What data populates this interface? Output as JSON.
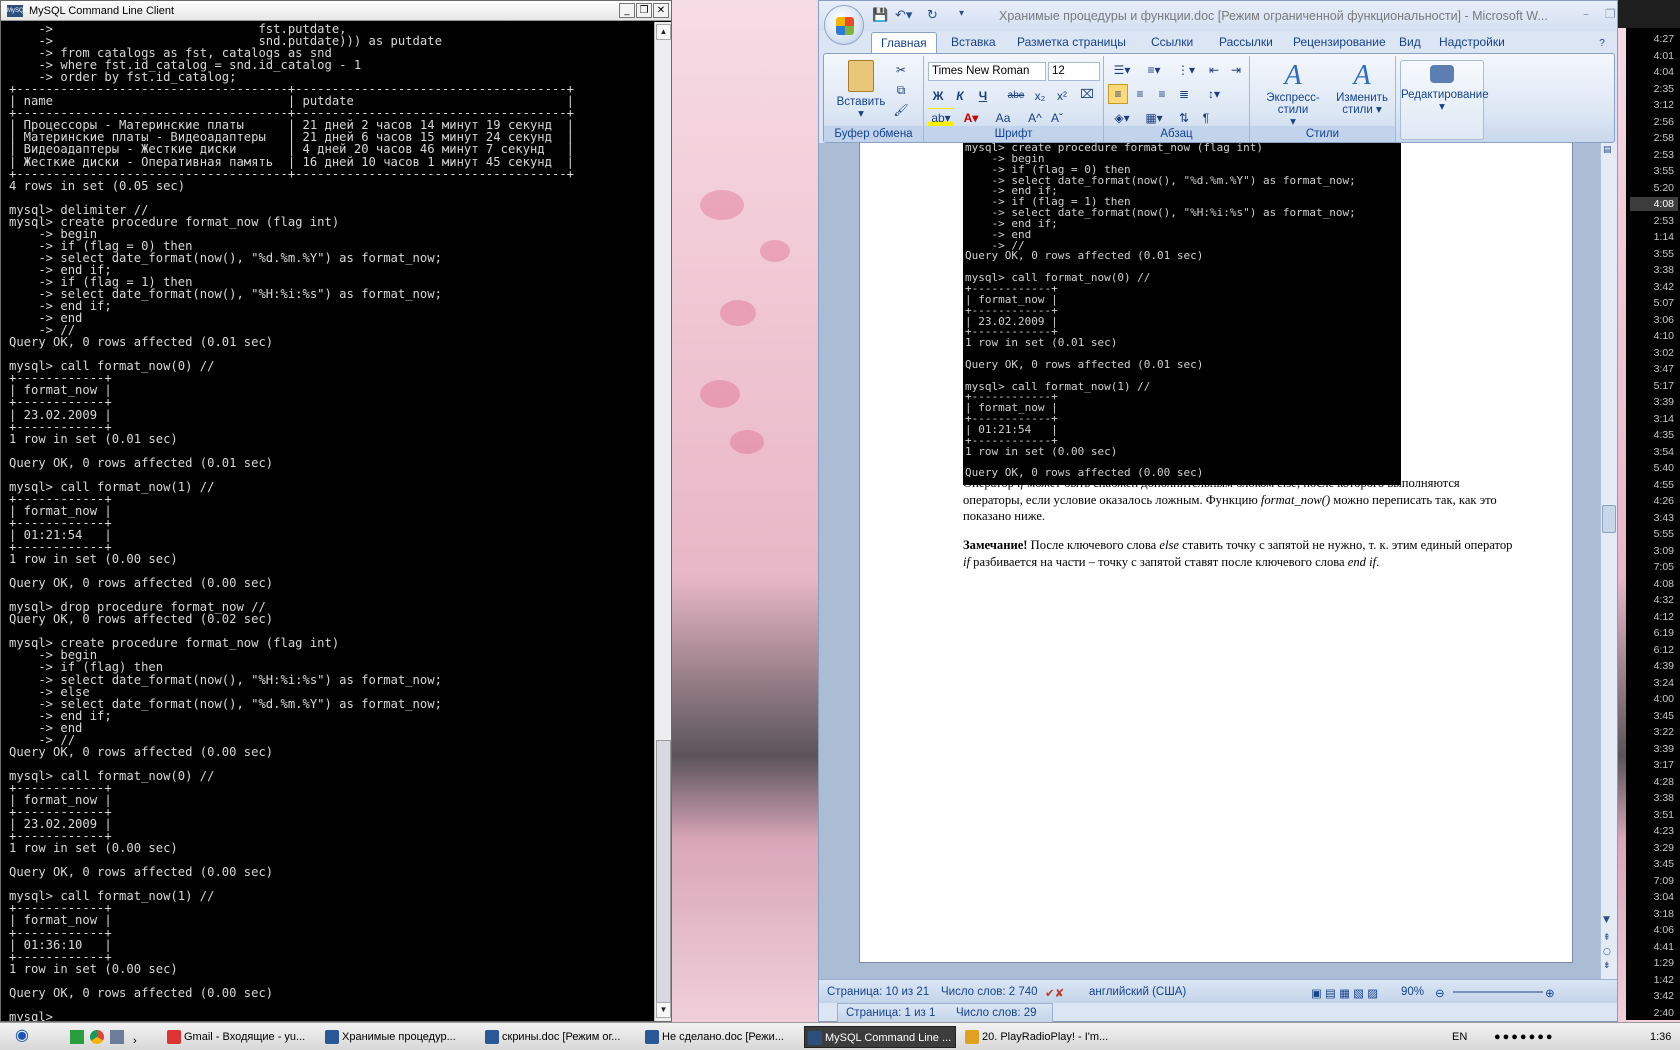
{
  "mysql_window": {
    "title": "MySQL Command Line Client",
    "icon_label": "MySQL",
    "lines": [
      "    ->                            fst.putdate,",
      "    ->                            snd.putdate))) as putdate",
      "    -> from catalogs as fst, catalogs as snd",
      "    -> where fst.id_catalog = snd.id_catalog - 1",
      "    -> order by fst.id_catalog;",
      "+-------------------------------------+-------------------------------------+",
      "| name                                | putdate                             |",
      "+-------------------------------------+-------------------------------------+",
      "| Процессоры - Материнские платы      | 21 дней 2 часов 14 минут 19 секунд  |",
      "| Материнские платы - Видеоадаптеры   | 21 дней 6 часов 15 минут 24 секунд  |",
      "| Видеоадаптеры - Жесткие диски       | 4 дней 20 часов 46 минут 7 секунд   |",
      "| Жесткие диски - Оперативная память  | 16 дней 10 часов 1 минут 45 секунд  |",
      "+-------------------------------------+-------------------------------------+",
      "4 rows in set (0.05 sec)",
      "",
      "mysql> delimiter //",
      "mysql> create procedure format_now (flag int)",
      "    -> begin",
      "    -> if (flag = 0) then",
      "    -> select date_format(now(), \"%d.%m.%Y\") as format_now;",
      "    -> end if;",
      "    -> if (flag = 1) then",
      "    -> select date_format(now(), \"%H:%i:%s\") as format_now;",
      "    -> end if;",
      "    -> end",
      "    -> //",
      "Query OK, 0 rows affected (0.01 sec)",
      "",
      "mysql> call format_now(0) //",
      "+------------+",
      "| format_now |",
      "+------------+",
      "| 23.02.2009 |",
      "+------------+",
      "1 row in set (0.01 sec)",
      "",
      "Query OK, 0 rows affected (0.01 sec)",
      "",
      "mysql> call format_now(1) //",
      "+------------+",
      "| format_now |",
      "+------------+",
      "| 01:21:54   |",
      "+------------+",
      "1 row in set (0.00 sec)",
      "",
      "Query OK, 0 rows affected (0.00 sec)",
      "",
      "mysql> drop procedure format_now //",
      "Query OK, 0 rows affected (0.02 sec)",
      "",
      "mysql> create procedure format_now (flag int)",
      "    -> begin",
      "    -> if (flag) then",
      "    -> select date_format(now(), \"%H:%i:%s\") as format_now;",
      "    -> else",
      "    -> select date_format(now(), \"%d.%m.%Y\") as format_now;",
      "    -> end if;",
      "    -> end",
      "    -> //",
      "Query OK, 0 rows affected (0.00 sec)",
      "",
      "mysql> call format_now(0) //",
      "+------------+",
      "| format_now |",
      "+------------+",
      "| 23.02.2009 |",
      "+------------+",
      "1 row in set (0.00 sec)",
      "",
      "Query OK, 0 rows affected (0.00 sec)",
      "",
      "mysql> call format_now(1) //",
      "+------------+",
      "| format_now |",
      "+------------+",
      "| 01:36:10   |",
      "+------------+",
      "1 row in set (0.00 sec)",
      "",
      "Query OK, 0 rows affected (0.00 sec)",
      "",
      "mysql> _"
    ]
  },
  "word_window": {
    "title": "Хранимые процедуры и функции.doc [Режим ограниченной функциональности] - Microsoft W...",
    "tabs": [
      "Главная",
      "Вставка",
      "Разметка страницы",
      "Ссылки",
      "Рассылки",
      "Рецензирование",
      "Вид",
      "Надстройки"
    ],
    "groups": {
      "clipboard": "Буфер обмена",
      "font": "Шрифт",
      "paragraph": "Абзац",
      "styles": "Стили"
    },
    "paste_label": "Вставить",
    "font_name": "Times New Roman",
    "font_size": "12",
    "bold": "Ж",
    "italic": "К",
    "underline": "Ч",
    "strike": "abe",
    "subscript": "x₂",
    "superscript": "x²",
    "case": "Аа",
    "grow": "A^",
    "shrink": "Aˇ",
    "pilcrow": "¶",
    "express_styles": "Экспресс-стили",
    "change_styles_1": "Изменить",
    "change_styles_2": "стили",
    "editing": "Редактирование",
    "doc_console_lines": [
      "mysql> create procedure format_now (flag int)",
      "    -> begin",
      "    -> if (flag = 0) then",
      "    -> select date_format(now(), \"%d.%m.%Y\") as format_now;",
      "    -> end if;",
      "    -> if (flag = 1) then",
      "    -> select date_format(now(), \"%H:%i:%s\") as format_now;",
      "    -> end if;",
      "    -> end",
      "    -> //",
      "Query OK, 0 rows affected (0.01 sec)",
      "",
      "mysql> call format_now(0) //",
      "+------------+",
      "| format_now |",
      "+------------+",
      "| 23.02.2009 |",
      "+------------+",
      "1 row in set (0.01 sec)",
      "",
      "Query OK, 0 rows affected (0.01 sec)",
      "",
      "mysql> call format_now(1) //",
      "+------------+",
      "| format_now |",
      "+------------+",
      "| 01:21:54   |",
      "+------------+",
      "1 row in set (0.00 sec)",
      "",
      "Query OK, 0 rows affected (0.00 sec)"
    ],
    "para1": {
      "a": "Оператор ",
      "b": "if",
      "c": " может быть снабжен дополнительным блоком ",
      "d": "else",
      "e": ", после которого выполняются операторы, если условие оказалось ложным. Функцию ",
      "f": "format_now()",
      "g": " можно переписать так, как это показано ниже."
    },
    "para2": {
      "a": "Замечание!",
      "b": " После ключевого слова ",
      "c": "else",
      "d": " ставить точку с запятой не нужно, т. к. этим единый оператор ",
      "e": "if",
      "f": " разбивается на части – точку с запятой ставят после ключевого слова ",
      "g": "end if",
      "h": "."
    },
    "status": {
      "page": "Страница: 10 из 21",
      "words": "Число слов: 2 740",
      "lang": "английский (США)",
      "zoom": "90%"
    },
    "status2": {
      "page": "Страница: 1 из 1",
      "words": "Число слов: 29"
    }
  },
  "right_strip": {
    "times": [
      "4:27",
      "4:01",
      "4:04",
      "2:35",
      "3:12",
      "2:56",
      "2:58",
      "2:53",
      "3:55",
      "5:20",
      "4:08",
      "2:53",
      "1:14",
      "3:55",
      "3:38",
      "3:42",
      "5:07",
      "3:06",
      "4:10",
      "3:02",
      "3:47",
      "5:17",
      "3:39",
      "3:14",
      "4:35",
      "3:54",
      "5:40",
      "4:55",
      "4:26",
      "3:43",
      "5:55",
      "3:09",
      "7:05",
      "4:08",
      "4:32",
      "4:12",
      "6:19",
      "6:12",
      "4:39",
      "3:24",
      "4:00",
      "3:45",
      "3:22",
      "3:39",
      "3:17",
      "4:28",
      "3:38",
      "3:51",
      "4:23",
      "3:29",
      "3:45",
      "7:09",
      "3:04",
      "3:18",
      "4:06",
      "4:41",
      "1:29",
      "1:42",
      "3:42",
      "2:40"
    ],
    "highlight_index": 10
  },
  "taskbar": {
    "tasks": [
      {
        "label": "Gmail - Входящие - yu...",
        "color": "#d33"
      },
      {
        "label": "Хранимые процедур...",
        "color": "#2b5797"
      },
      {
        "label": "скрины.doc [Режим ог...",
        "color": "#2b5797"
      },
      {
        "label": "Не сделано.doc [Режи...",
        "color": "#2b5797"
      },
      {
        "label": "MySQL Command Line ...",
        "color": "#2c4f7c"
      },
      {
        "label": "20. PlayRadioPlay! - I'm...",
        "color": "#e0a020"
      }
    ],
    "lang": "EN",
    "clock": "1:36"
  }
}
